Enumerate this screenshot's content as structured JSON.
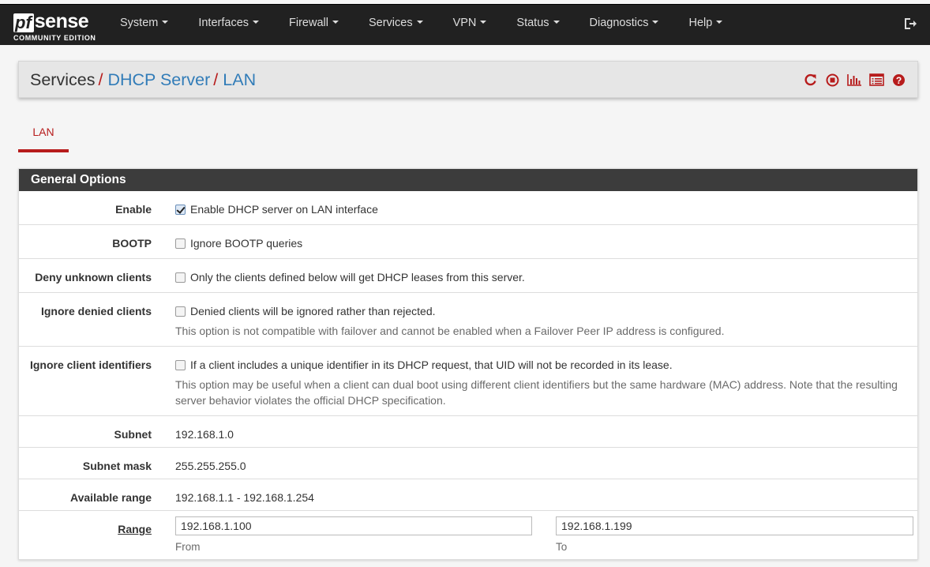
{
  "brand": {
    "logo_pf": "pf",
    "logo_sense": "sense",
    "edition": "COMMUNITY EDITION"
  },
  "nav": {
    "items": [
      {
        "label": "System"
      },
      {
        "label": "Interfaces"
      },
      {
        "label": "Firewall"
      },
      {
        "label": "Services"
      },
      {
        "label": "VPN"
      },
      {
        "label": "Status"
      },
      {
        "label": "Diagnostics"
      },
      {
        "label": "Help"
      }
    ],
    "logout_icon": "sign-out-icon"
  },
  "breadcrumb": {
    "level1": "Services",
    "level2": "DHCP Server",
    "level3": "LAN",
    "separator": "/",
    "icons": [
      "restart-icon",
      "stop-icon",
      "chart-icon",
      "list-icon",
      "help-icon"
    ],
    "icon_color": "#b71c1c"
  },
  "tabs": [
    {
      "label": "LAN",
      "active": true
    }
  ],
  "panel": {
    "title": "General Options",
    "rows": {
      "enable": {
        "label": "Enable",
        "text": "Enable DHCP server on LAN interface",
        "checked": true
      },
      "bootp": {
        "label": "BOOTP",
        "text": "Ignore BOOTP queries",
        "checked": false
      },
      "deny_unknown": {
        "label": "Deny unknown clients",
        "text": "Only the clients defined below will get DHCP leases from this server.",
        "checked": false
      },
      "ignore_denied": {
        "label": "Ignore denied clients",
        "text": "Denied clients will be ignored rather than rejected.",
        "checked": false,
        "help": "This option is not compatible with failover and cannot be enabled when a Failover Peer IP address is configured."
      },
      "ignore_client_ids": {
        "label": "Ignore client identifiers",
        "text": "If a client includes a unique identifier in its DHCP request, that UID will not be recorded in its lease.",
        "checked": false,
        "help_line1": "This option may be useful when a client can dual boot using different client identifiers but the same hardware (MAC) address. Note that the resulting",
        "help_line2": "server behavior violates the official DHCP specification."
      },
      "subnet": {
        "label": "Subnet",
        "value": "192.168.1.0"
      },
      "subnet_mask": {
        "label": "Subnet mask",
        "value": "255.255.255.0"
      },
      "available_range": {
        "label": "Available range",
        "value": "192.168.1.1 - 192.168.1.254"
      },
      "range": {
        "label": "Range",
        "from_value": "192.168.1.100",
        "from_label": "From",
        "to_value": "192.168.1.199",
        "to_label": "To"
      }
    }
  },
  "colors": {
    "navbar": "#212121",
    "accent_red": "#b71c1c",
    "link_blue": "#317cb8",
    "panel_heading": "#3c3c3c"
  }
}
